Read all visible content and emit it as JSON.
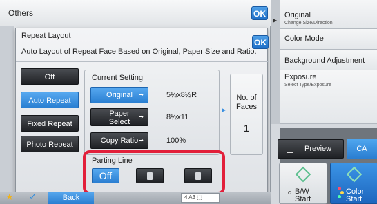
{
  "bg_window": {
    "title": "Others",
    "ok_label": "OK"
  },
  "dialog": {
    "title": "Repeat Layout",
    "ok_label": "OK",
    "description": "Auto Layout of Repeat Face Based on Original, Paper Size and Ratio.",
    "modes": [
      {
        "label": "Off",
        "selected": false
      },
      {
        "label": "Auto Repeat",
        "selected": true
      },
      {
        "label": "Fixed Repeat",
        "selected": false
      },
      {
        "label": "Photo Repeat",
        "selected": false
      }
    ],
    "current_setting": {
      "label": "Current Setting",
      "rows": [
        {
          "button": "Original",
          "value": "5½x8½R",
          "selected": true
        },
        {
          "button": "Paper Select",
          "value": "8½x11",
          "selected": false
        },
        {
          "button": "Copy Ratio",
          "value": "100%",
          "selected": false
        }
      ]
    },
    "faces": {
      "label": "No. of Faces",
      "value": "1"
    },
    "parting_line": {
      "label": "Parting Line",
      "off_label": "Off"
    }
  },
  "bottom_bar": {
    "back_label": "Back",
    "page_indicator": "4  A3  ⬚"
  },
  "right_panel": {
    "items": [
      {
        "title": "Original",
        "sub": "Change Size/Direction."
      },
      {
        "title": "Color Mode",
        "sub": ""
      },
      {
        "title": "Background Adjustment",
        "sub": ""
      },
      {
        "title": "Exposure",
        "sub": "Select Type/Exposure"
      }
    ],
    "preview_label": "Preview",
    "ca_label": "CA",
    "bw_start": [
      "B/W",
      "Start"
    ],
    "color_start": [
      "Color",
      "Start"
    ]
  },
  "colors": {
    "accent": "#2a7fd2",
    "highlight": "#e21f3a"
  }
}
